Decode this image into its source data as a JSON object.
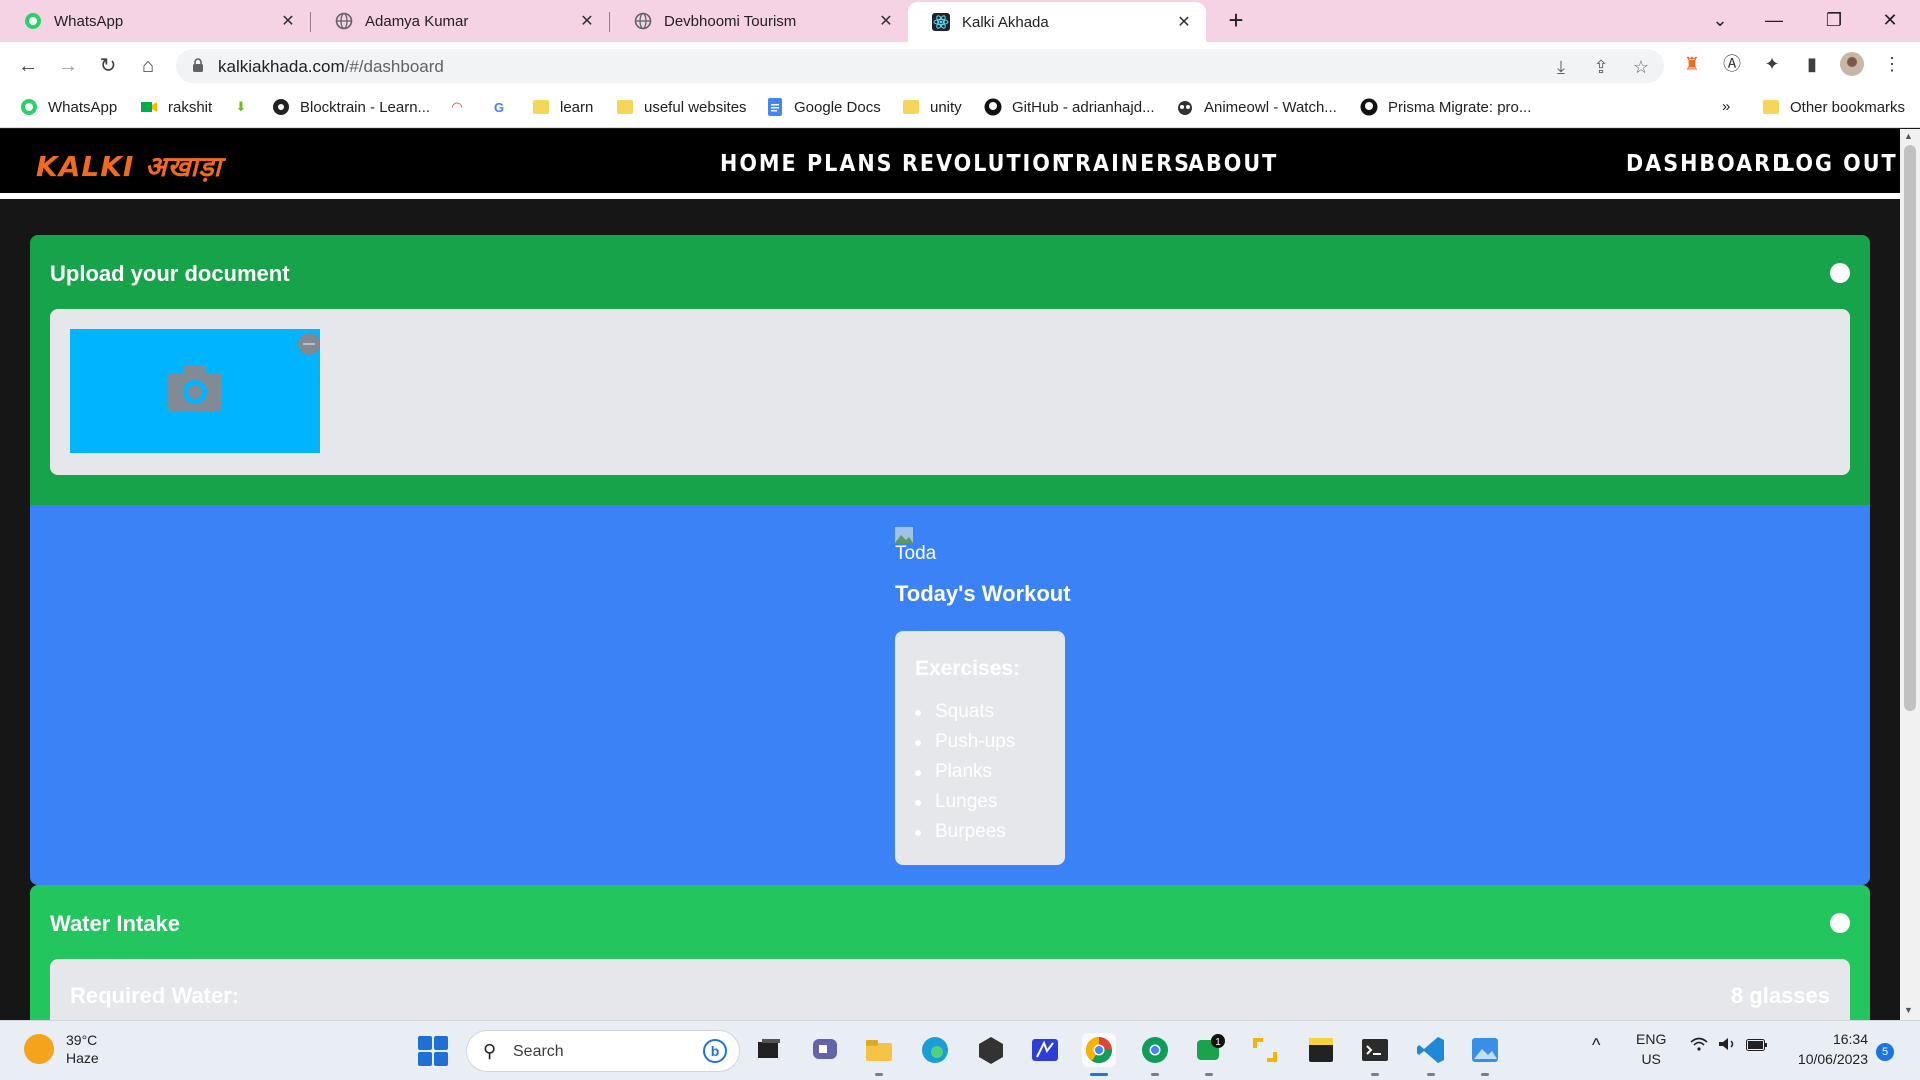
{
  "browser": {
    "tabs": [
      {
        "title": "WhatsApp",
        "icon": "whatsapp-icon",
        "active": false
      },
      {
        "title": "Adamya Kumar",
        "icon": "globe-icon",
        "active": false
      },
      {
        "title": "Devbhoomi Tourism",
        "icon": "globe-icon",
        "active": false
      },
      {
        "title": "Kalki Akhada",
        "icon": "react-icon",
        "active": true
      }
    ],
    "new_tab": "+",
    "url_host": "kalkiakhada.com",
    "url_path": "/#/dashboard",
    "bookmarks": [
      {
        "label": "WhatsApp",
        "icon": "whatsapp-icon"
      },
      {
        "label": "rakshit",
        "icon": "meet-icon"
      },
      {
        "label": "",
        "icon": "download-arrow-icon"
      },
      {
        "label": "Blocktrain - Learn...",
        "icon": "globe-icon"
      },
      {
        "label": "",
        "icon": "speedometer-icon"
      },
      {
        "label": "",
        "icon": "google-icon"
      },
      {
        "label": "learn",
        "icon": "folder-icon"
      },
      {
        "label": "useful websites",
        "icon": "folder-icon"
      },
      {
        "label": "Google Docs",
        "icon": "docs-icon"
      },
      {
        "label": "unity",
        "icon": "folder-icon"
      },
      {
        "label": "GitHub - adrianhajd...",
        "icon": "github-icon"
      },
      {
        "label": "Animeowl - Watch...",
        "icon": "owl-icon"
      },
      {
        "label": "Prisma Migrate: pro...",
        "icon": "github-icon"
      }
    ],
    "more_bookmarks": "»",
    "other_bookmarks": "Other bookmarks"
  },
  "site": {
    "logo_text": "KALKI अखाड़ा",
    "nav": {
      "links": [
        "HOME",
        "PLANS",
        "REVOLUTION",
        "TRAINERS",
        "ABOUT"
      ],
      "dashboard": "DASHBOARD",
      "logout": "LOG OUT"
    },
    "upload": {
      "title": "Upload your document"
    },
    "workout": {
      "broken_image_alt": "Toda",
      "title": "Today's Workout",
      "exercises_heading": "Exercises:",
      "exercises": [
        "Squats",
        "Push-ups",
        "Planks",
        "Lunges",
        "Burpees"
      ]
    },
    "water": {
      "title": "Water Intake",
      "required_label": "Required Water:",
      "required_value": "8 glasses"
    }
  },
  "taskbar": {
    "temperature": "39°C",
    "condition": "Haze",
    "search_placeholder": "Search",
    "language": "ENG",
    "region": "US",
    "time": "16:34",
    "date": "10/06/2023",
    "notifications": "5",
    "chat_badge": "1"
  },
  "colors": {
    "upload_bg": "#16a34a",
    "workout_bg": "#3b82f6",
    "water_bg": "#22c55e",
    "photo_bg": "#00b4ff",
    "logo": "#f26b1d"
  }
}
